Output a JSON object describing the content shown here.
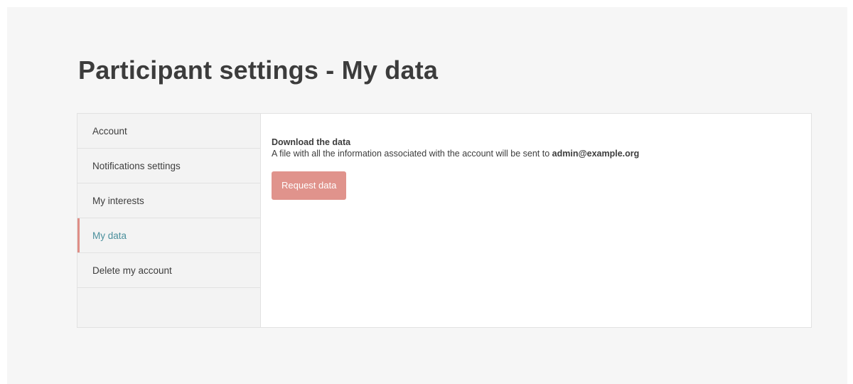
{
  "page": {
    "title": "Participant settings - My data"
  },
  "sidebar": {
    "items": [
      {
        "label": "Account"
      },
      {
        "label": "Notifications settings"
      },
      {
        "label": "My interests"
      },
      {
        "label": "My data",
        "active": true
      },
      {
        "label": "Delete my account"
      }
    ]
  },
  "main": {
    "section_title": "Download the data",
    "description_prefix": "A file with all the information associated with the account will be sent to ",
    "email": "admin@example.org",
    "request_button_label": "Request data"
  },
  "colors": {
    "active_accent": "#df8e87",
    "active_text": "#4a8f9c",
    "button_bg": "#e0938c"
  }
}
